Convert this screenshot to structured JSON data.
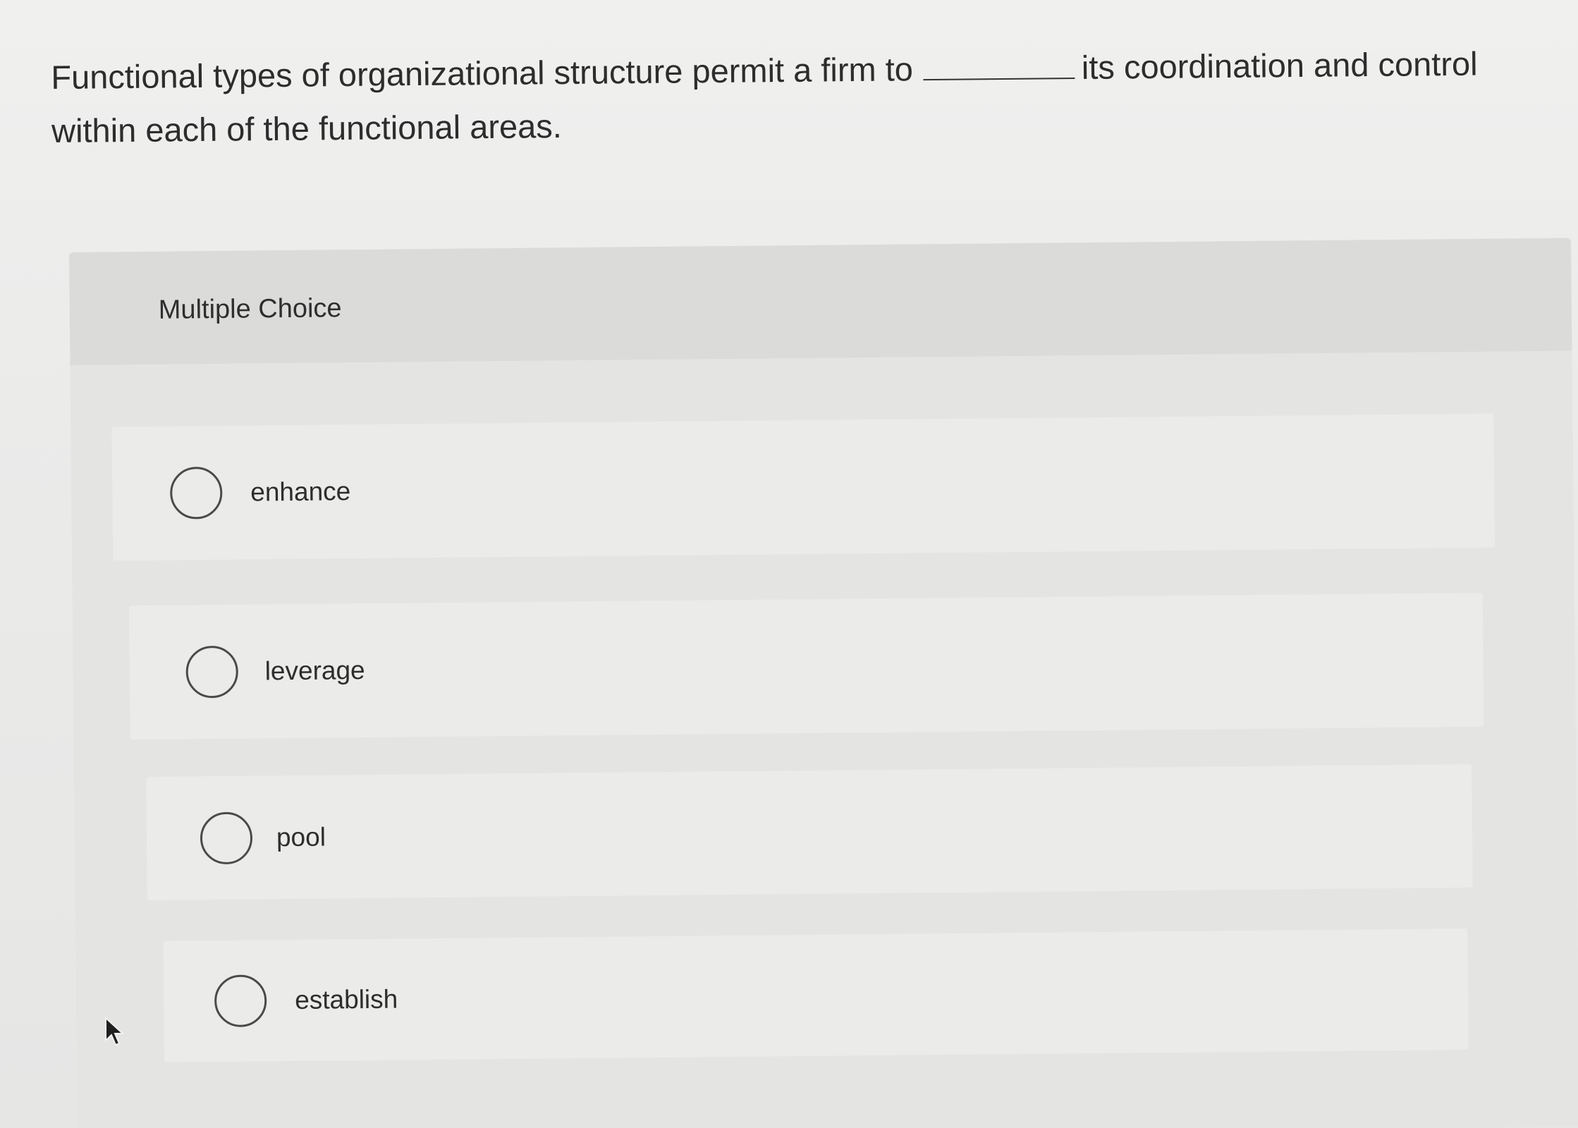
{
  "question": {
    "text_before_blank": "Functional types of organizational structure permit a firm to",
    "text_after_blank": "its coordination and control within each of the functional areas."
  },
  "multiple_choice": {
    "title": "Multiple Choice",
    "options": [
      {
        "label": "enhance"
      },
      {
        "label": "leverage"
      },
      {
        "label": "pool"
      },
      {
        "label": "establish"
      }
    ]
  },
  "icons": {
    "radio": "radio-unselected-icon",
    "cursor": "mouse-pointer-icon"
  },
  "colors": {
    "background": "#ececeb",
    "panel": "#e1e1e0",
    "option_row": "#ebebea",
    "text": "#2d2d2d",
    "radio_border": "#4a4a4a"
  }
}
